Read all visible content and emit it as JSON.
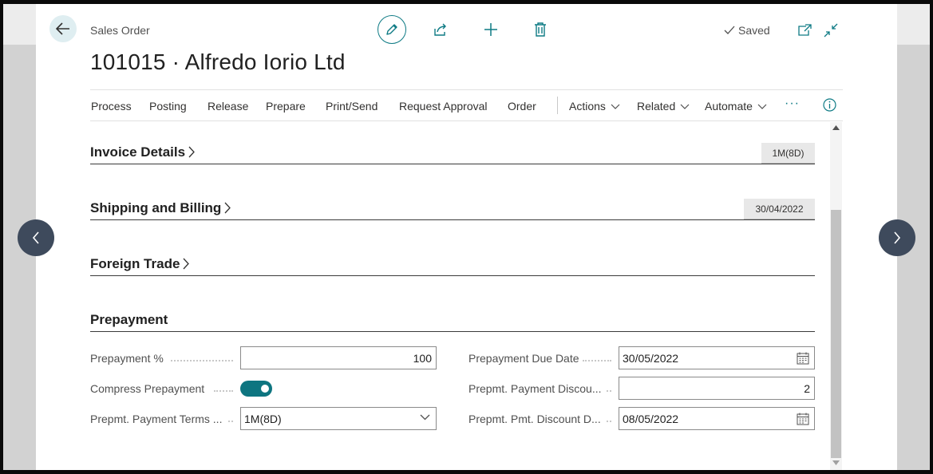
{
  "header": {
    "breadcrumb": "Sales Order",
    "title": "101015 · Alfredo Iorio Ltd",
    "status": "Saved",
    "icons": [
      "back-arrow-icon",
      "edit-pencil-icon",
      "share-icon",
      "add-icon",
      "delete-icon",
      "check-icon",
      "open-new-window-icon",
      "collapse-icon"
    ]
  },
  "actionbar": {
    "items": [
      "Process",
      "Posting",
      "Release",
      "Prepare",
      "Print/Send",
      "Request Approval",
      "Order"
    ],
    "menus": [
      "Actions",
      "Related",
      "Automate"
    ],
    "more": "···"
  },
  "sections": {
    "invoice_details": {
      "title": "Invoice Details",
      "badge": "1M(8D)"
    },
    "shipping_billing": {
      "title": "Shipping and Billing",
      "badge": "30/04/2022"
    },
    "foreign_trade": {
      "title": "Foreign Trade"
    },
    "prepayment": {
      "title": "Prepayment"
    }
  },
  "prepayment_fields": {
    "prepayment_pct": {
      "label": "Prepayment %",
      "value": "100"
    },
    "compress_prepayment": {
      "label": "Compress Prepayment",
      "on": true
    },
    "payment_terms": {
      "label": "Prepmt. Payment Terms ...",
      "value": "1M(8D)"
    },
    "due_date": {
      "label": "Prepayment Due Date",
      "value": "30/05/2022"
    },
    "payment_discount": {
      "label": "Prepmt. Payment Discou...",
      "value": "2"
    },
    "pmt_discount_date": {
      "label": "Prepmt. Pmt. Discount D...",
      "value": "08/05/2022"
    }
  },
  "colors": {
    "accent": "#0e7580",
    "nav_circle": "#3e4a5c"
  }
}
